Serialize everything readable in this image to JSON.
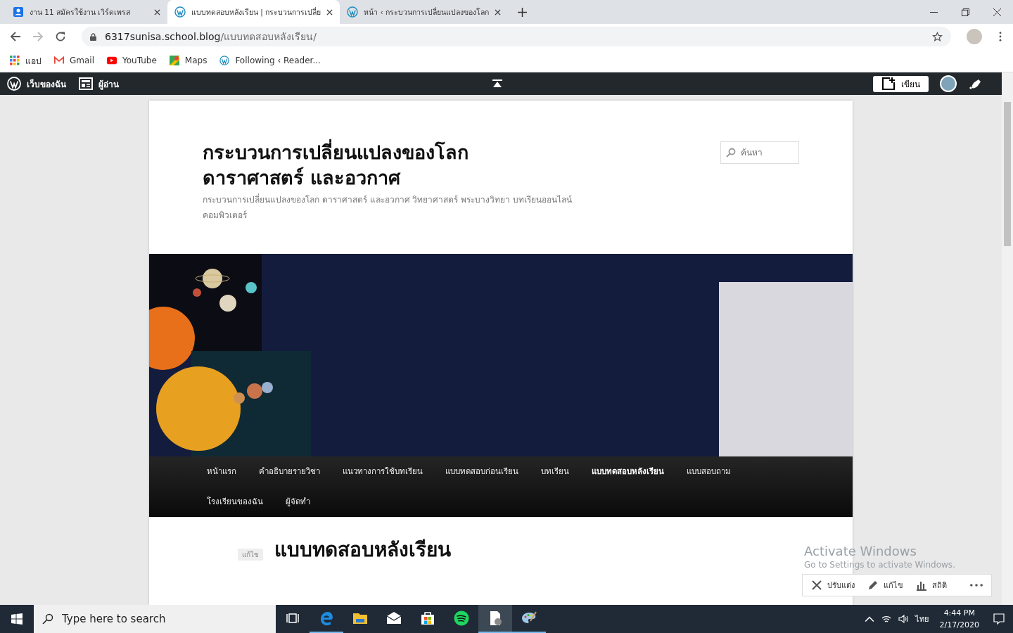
{
  "browser": {
    "tabs": [
      {
        "title": "งาน 11 สมัครใช้งาน เวิร์ดเพรส",
        "kind": "contact",
        "selected": false
      },
      {
        "title": "แบบทดสอบหลังเรียน | กระบวนการเปลี่ย",
        "kind": "wordpress",
        "selected": true
      },
      {
        "title": "หน้า ‹ กระบวนการเปลี่ยนแปลงของโลก",
        "kind": "wordpress",
        "selected": false
      }
    ],
    "address": {
      "domain": "6317sunisa.school.blog",
      "path": "/แบบทดสอบหลังเรียน/"
    },
    "bookmarks": [
      {
        "label": "แอป",
        "kind": "apps"
      },
      {
        "label": "Gmail",
        "kind": "gmail"
      },
      {
        "label": "YouTube",
        "kind": "youtube"
      },
      {
        "label": "Maps",
        "kind": "maps"
      },
      {
        "label": "Following ‹ Reader...",
        "kind": "wordpress"
      }
    ]
  },
  "admin_bar": {
    "items": [
      {
        "label": "เว็บของฉัน",
        "kind": "wordpress"
      },
      {
        "label": "ผู้อ่าน",
        "kind": "reader"
      }
    ],
    "write_button": "เขียน"
  },
  "site": {
    "title": "กระบวนการเปลี่ยนแปลงของโลก ดาราศาสตร์ และอวกาศ",
    "tagline": "กระบวนการเปลี่ยนแปลงของโลก ดาราศาสตร์ และอวกาศ วิทยาศาสตร์ พระบางวิทยา บทเรียนออนไลน์ คอมพิวเตอร์",
    "search": {
      "placeholder": "ค้นหา"
    }
  },
  "nav": {
    "items": [
      {
        "label": "หน้าแรก",
        "selected": false
      },
      {
        "label": "คำอธิบายรายวิชา",
        "selected": false
      },
      {
        "label": "แนวทางการใช้บทเรียน",
        "selected": false
      },
      {
        "label": "แบบทดสอบก่อนเรียน",
        "selected": false
      },
      {
        "label": "บทเรียน",
        "selected": false
      },
      {
        "label": "แบบทดสอบหลังเรียน",
        "selected": true
      },
      {
        "label": "แบบสอบถาม",
        "selected": false
      },
      {
        "label": "โรงเรียนของฉัน",
        "selected": false
      },
      {
        "label": "ผู้จัดทำ",
        "selected": false
      }
    ]
  },
  "post": {
    "edit_link": "แก้ไข",
    "title": "แบบทดสอบหลังเรียน"
  },
  "activation_notice": {
    "title": "Activate Windows",
    "subtitle": "Go to Settings to activate Windows."
  },
  "action_bar": {
    "items": [
      {
        "label": "ปรับแต่ง",
        "kind": "customize"
      },
      {
        "label": "แก้ไข",
        "kind": "edit"
      },
      {
        "label": "สถิติ",
        "kind": "stats"
      }
    ]
  },
  "taskbar": {
    "search_placeholder": "Type here to search",
    "apps": [
      {
        "kind": "task-view",
        "running": false,
        "selected": false
      },
      {
        "kind": "edge",
        "running": true,
        "selected": false
      },
      {
        "kind": "explorer",
        "running": false,
        "selected": false
      },
      {
        "kind": "mail",
        "running": false,
        "selected": false
      },
      {
        "kind": "store",
        "running": false,
        "selected": false
      },
      {
        "kind": "spotify",
        "running": false,
        "selected": false
      },
      {
        "kind": "document",
        "running": true,
        "selected": true
      },
      {
        "kind": "paint",
        "running": true,
        "selected": false
      }
    ],
    "language": "ไทย",
    "time": "4:44 PM",
    "date": "2/17/2020"
  }
}
